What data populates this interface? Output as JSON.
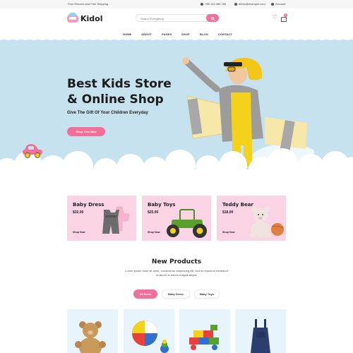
{
  "topbar": {
    "shipping": "Free Returns and Free Shipping",
    "phone": "+00 123 456 789",
    "email": "demo@example.com",
    "account": "Account"
  },
  "header": {
    "logo_text": "Kidol",
    "search_placeholder": "Search Everything",
    "cart_count": "0"
  },
  "nav": {
    "items": [
      "HOME",
      "ABOUT",
      "PAGES",
      "SHOP",
      "BLOG",
      "CONTACT"
    ]
  },
  "hero": {
    "title_line1": "Best Kids Store",
    "title_line2": "& Online Shop",
    "subtitle": "Give The Gift Of Your Children Everyday",
    "button": "Shop This Now"
  },
  "categories": [
    {
      "name": "Baby Dress",
      "price": "$32.00",
      "link": "Shop Now"
    },
    {
      "name": "Baby Toys",
      "price": "$25.00",
      "link": "Shop Now"
    },
    {
      "name": "Teddy Bear",
      "price": "$18.00",
      "link": "Shop Now"
    }
  ],
  "new_products": {
    "title": "New Products",
    "description": "Lorem ipsum dolor sit amet, consectetur adipisicing elit, sed do eiusmod incididunt ut labore et dolore magna aliqua.",
    "tabs": [
      "All Items",
      "Baby Dress",
      "Baby Toys"
    ],
    "active_tab": "All Items"
  },
  "colors": {
    "accent": "#f0709a",
    "hero_bg": "#c6e2ee",
    "card_pink": "#fad4e4",
    "product_bg": "#e8f4fb"
  }
}
